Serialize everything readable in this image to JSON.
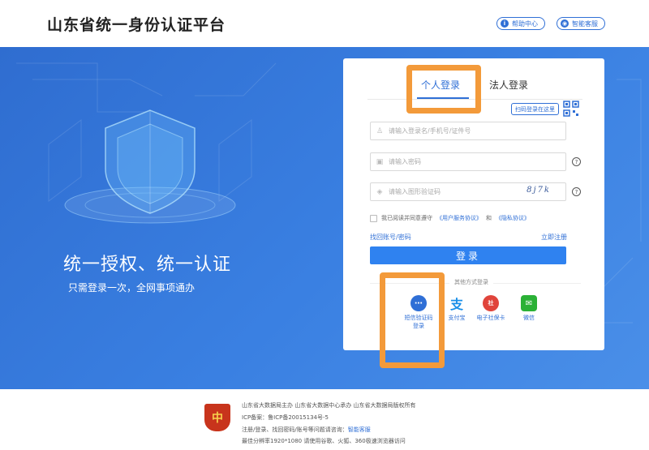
{
  "header": {
    "title": "山东省统一身份认证平台",
    "help_label": "帮助中心",
    "service_label": "智能客服"
  },
  "banner": {
    "slogan_main": "统一授权、统一认证",
    "slogan_sub": "只需登录一次，全网事项通办"
  },
  "login": {
    "tab_personal": "个人登录",
    "tab_corp": "法人登录",
    "qr_tip": "扫码登录在这里",
    "username_placeholder": "请输入登录名/手机号/证件号",
    "password_placeholder": "请输入密码",
    "captcha_placeholder": "请输入图形验证码",
    "captcha_text": "8j7k",
    "agree_prefix": "我已阅读并同意遵守",
    "agree_user_link": "《用户服务协议》",
    "agree_and": "和",
    "agree_privacy_link": "《隐私协议》",
    "forgot_label": "找回账号/密码",
    "register_label": "立即注册",
    "login_button": "登录",
    "other_methods_label": "其他方式登录",
    "alt_methods": [
      {
        "label": "短信验证码登录",
        "icon": "sms-icon"
      },
      {
        "label": "支付宝",
        "icon": "alipay-icon"
      },
      {
        "label": "电子社保卡",
        "icon": "social-security-card-icon"
      },
      {
        "label": "微信",
        "icon": "wechat-icon"
      }
    ]
  },
  "footer": {
    "line1": "山东省大数据局主办  山东省大数据中心承办  山东省大数据局版权所有",
    "line2": "ICP备案：鲁ICP备20015134号-5",
    "line3_prefix": "注册/登录、找回密码/账号等问题请咨询：",
    "line3_link": "智能客服",
    "line4": "最佳分辨率1920*1080 请使用谷歌、火狐、360极速浏览器访问"
  },
  "colors": {
    "primary": "#2f6fd6",
    "highlight": "#f39a3a",
    "banner": "#3a80e2"
  }
}
